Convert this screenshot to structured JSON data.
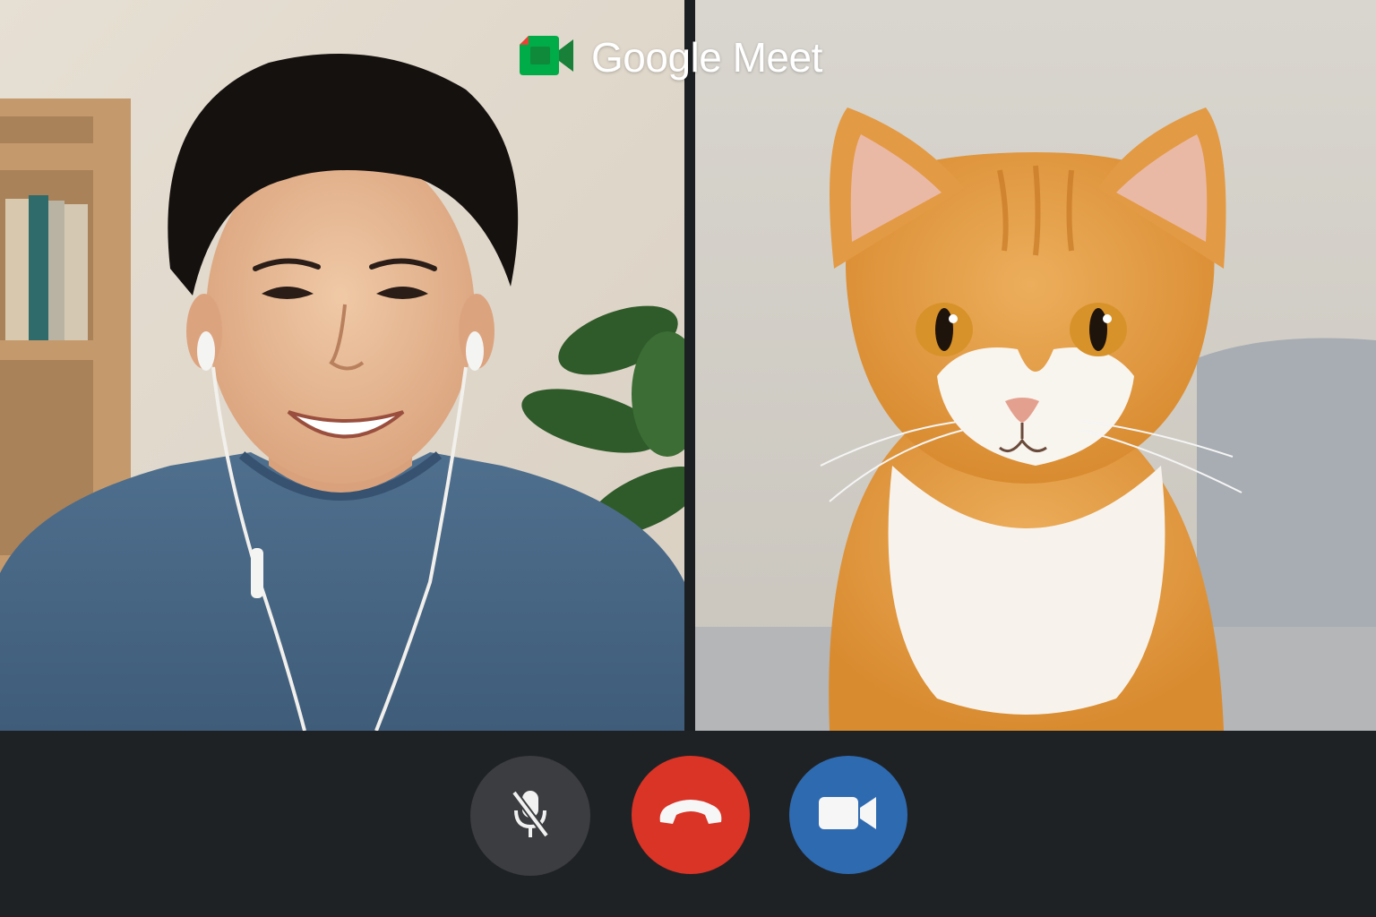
{
  "app": {
    "brand_name": "Google Meet",
    "brand_colors": {
      "green": "#00ac47",
      "dark_green": "#188038"
    }
  },
  "participants": [
    {
      "kind": "person",
      "description_icon": "person-video-feed"
    },
    {
      "kind": "cat",
      "description_icon": "cat-video-feed"
    }
  ],
  "controls": {
    "mic": {
      "state": "muted",
      "icon": "mic-off-icon",
      "color": "#3b3d40"
    },
    "end_call": {
      "icon": "phone-hangup-icon",
      "color": "#d93426"
    },
    "camera": {
      "state": "on",
      "icon": "videocam-icon",
      "color": "#2e6ab0"
    }
  },
  "colors": {
    "toolbar_bg": "#1f2225"
  }
}
